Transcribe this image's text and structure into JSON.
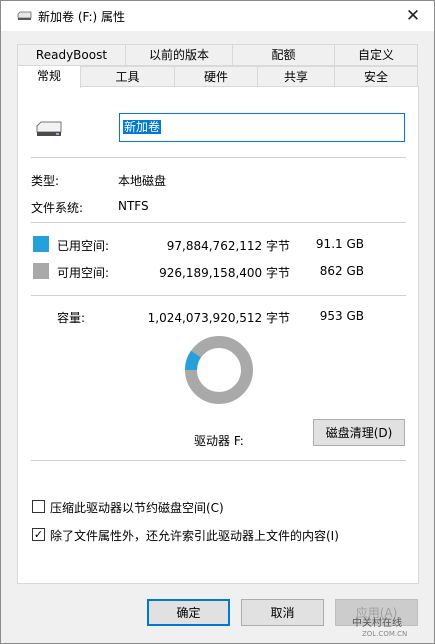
{
  "window": {
    "title": "新加卷 (F:) 属性",
    "close_glyph": "✕"
  },
  "tabs": {
    "row1": [
      "ReadyBoost",
      "以前的版本",
      "配额",
      "自定义"
    ],
    "row2": [
      "常规",
      "工具",
      "硬件",
      "共享",
      "安全"
    ],
    "active": "常规"
  },
  "general": {
    "volume_name": "新加卷",
    "type_label": "类型:",
    "type_value": "本地磁盘",
    "fs_label": "文件系统:",
    "fs_value": "NTFS",
    "used_label": "已用空间:",
    "used_bytes": "97,884,762,112 字节",
    "used_gb": "91.1 GB",
    "free_label": "可用空间:",
    "free_bytes": "926,189,158,400 字节",
    "free_gb": "862 GB",
    "capacity_label": "容量:",
    "capacity_bytes": "1,024,073,920,512 字节",
    "capacity_gb": "953 GB",
    "drive_label": "驱动器 F:",
    "cleanup_button": "磁盘清理(D)",
    "compress_label": "压缩此驱动器以节约磁盘空间(C)",
    "compress_checked": false,
    "index_label": "除了文件属性外，还允许索引此驱动器上文件的内容(I)",
    "index_checked": true,
    "used_fraction": 0.0956
  },
  "colors": {
    "used": "#26a0da",
    "free": "#a9a9a9",
    "accent": "#0078d7"
  },
  "buttons": {
    "ok": "确定",
    "cancel": "取消",
    "apply": "应用(A)"
  },
  "watermark": {
    "brand": "中关村在线",
    "url": "ZOL.COM.CN"
  }
}
